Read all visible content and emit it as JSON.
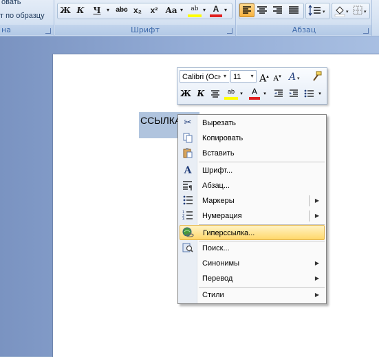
{
  "ribbon": {
    "clipboard_item_1": "овать",
    "clipboard_item_2": "т по образцу",
    "clipboard_group_label": "на",
    "font_group_label": "Шрифт",
    "paragraph_group_label": "Абзац",
    "font_buttons": {
      "bold": "Ж",
      "italic": "К",
      "underline": "Ч",
      "strike": "abc",
      "subscript": "x₂",
      "superscript": "x²",
      "case": "Aa",
      "highlight": "ab",
      "font_color": "A"
    }
  },
  "document": {
    "selected_text": "ССЫЛКА"
  },
  "mini_toolbar": {
    "font_name": "Calibri (Осн",
    "font_size": "11",
    "grow": "A",
    "shrink": "A",
    "bold": "Ж",
    "italic": "К",
    "highlight": "ab",
    "font_color": "A"
  },
  "context_menu": {
    "items": [
      {
        "label": "Вырезать",
        "icon": "scissors-icon"
      },
      {
        "label": "Копировать",
        "icon": "copy-icon"
      },
      {
        "label": "Вставить",
        "icon": "paste-icon"
      },
      {
        "label": "Шрифт...",
        "icon": "font-icon"
      },
      {
        "label": "Абзац...",
        "icon": "paragraph-icon"
      },
      {
        "label": "Маркеры",
        "icon": "bullets-icon",
        "submenu": true
      },
      {
        "label": "Нумерация",
        "icon": "numbering-icon",
        "submenu": true
      },
      {
        "label": "Гиперссылка...",
        "icon": "hyperlink-icon",
        "highlighted": true
      },
      {
        "label": "Поиск...",
        "icon": "research-icon"
      },
      {
        "label": "Синонимы",
        "submenu": true
      },
      {
        "label": "Перевод",
        "submenu": true
      },
      {
        "label": "Стили",
        "submenu": true
      }
    ]
  },
  "colors": {
    "highlight_yellow": "#ffff00",
    "font_red": "#e02020",
    "menu_highlight": "#ffd86b",
    "selection": "#b0c4de"
  }
}
